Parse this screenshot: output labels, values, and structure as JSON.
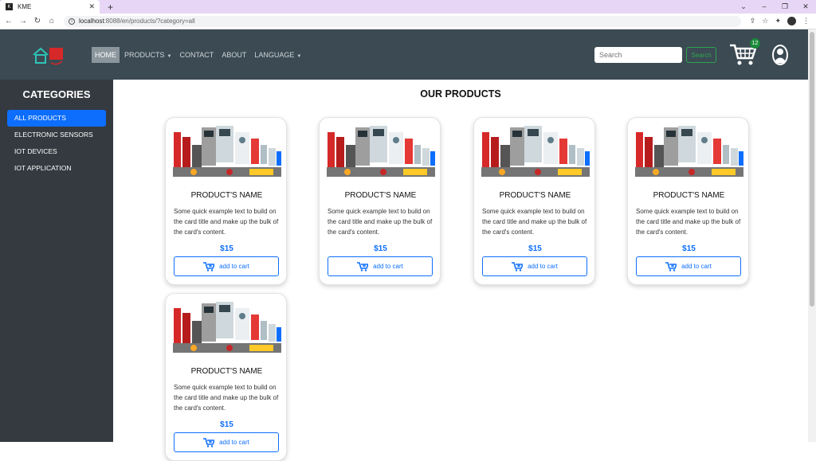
{
  "browser": {
    "tab_title": "KME",
    "favicon": "K",
    "url_host": "localhost",
    "url_path": ":8088/en/products/?category=all"
  },
  "navbar": {
    "menu": [
      {
        "label": "HOME",
        "dropdown": false
      },
      {
        "label": "PRODUCTS",
        "dropdown": true
      },
      {
        "label": "CONTACT",
        "dropdown": false
      },
      {
        "label": "ABOUT",
        "dropdown": false
      },
      {
        "label": "LANGUAGE",
        "dropdown": true
      }
    ],
    "search_placeholder": "Search",
    "search_button": "Search",
    "cart_count": "12"
  },
  "sidebar": {
    "title": "CATEGORIES",
    "items": [
      "ALL PRODUCTS",
      "ELECTRONIC SENSORS",
      "IOT DEVICES",
      "IOT APPLICATION"
    ]
  },
  "main": {
    "title": "OUR PRODUCTS",
    "products": [
      {
        "name": "PRODUCT'S NAME",
        "desc": "Some quick example text to build on the card title and make up the bulk of the card's content.",
        "price": "$15",
        "button": "add to cart"
      },
      {
        "name": "PRODUCT'S NAME",
        "desc": "Some quick example text to build on the card title and make up the bulk of the card's content.",
        "price": "$15",
        "button": "add to cart"
      },
      {
        "name": "PRODUCT'S NAME",
        "desc": "Some quick example text to build on the card title and make up the bulk of the card's content.",
        "price": "$15",
        "button": "add to cart"
      },
      {
        "name": "PRODUCT'S NAME",
        "desc": "Some quick example text to build on the card title and make up the bulk of the card's content.",
        "price": "$15",
        "button": "add to cart"
      },
      {
        "name": "PRODUCT'S NAME",
        "desc": "Some quick example text to build on the card title and make up the bulk of the card's content.",
        "price": "$15",
        "button": "add to cart"
      }
    ]
  },
  "colors": {
    "navbar": "#3b4a53",
    "sidebar": "#343a40",
    "accent": "#0d6efd",
    "success": "#2ea44f"
  }
}
